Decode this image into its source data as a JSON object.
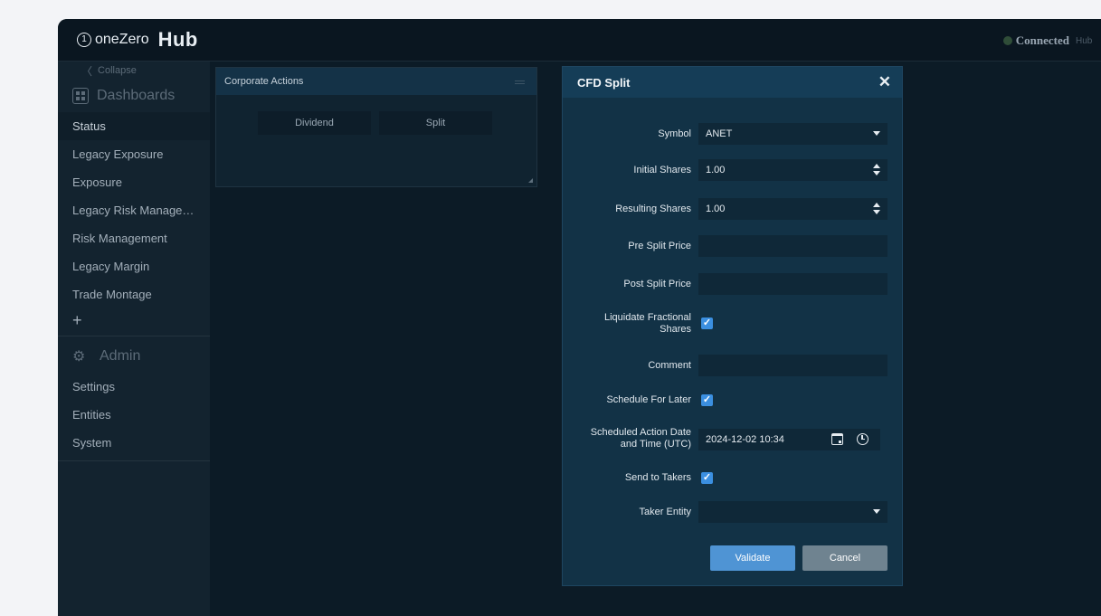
{
  "header": {
    "logo_mark": "1",
    "logo_text": "oneZero",
    "logo_hub": "Hub",
    "status": "Connected",
    "status_suffix": "Hub"
  },
  "sidebar": {
    "collapse_label": "Collapse",
    "dashboards_label": "Dashboards",
    "dashboard_items": [
      "Status",
      "Legacy Exposure",
      "Exposure",
      "Legacy Risk Manage…",
      "Risk Management",
      "Legacy Margin",
      "Trade Montage"
    ],
    "add_label": "+",
    "admin_label": "Admin",
    "admin_items": [
      "Settings",
      "Entities",
      "System"
    ]
  },
  "corporate_actions": {
    "title": "Corporate Actions",
    "dividend_label": "Dividend",
    "split_label": "Split"
  },
  "modal": {
    "title": "CFD Split",
    "close": "✕",
    "fields": {
      "symbol": {
        "label": "Symbol",
        "value": "ANET"
      },
      "initial_shares": {
        "label": "Initial Shares",
        "value": "1.00"
      },
      "resulting_shares": {
        "label": "Resulting Shares",
        "value": "1.00"
      },
      "pre_split_price": {
        "label": "Pre Split Price",
        "value": ""
      },
      "post_split_price": {
        "label": "Post Split Price",
        "value": ""
      },
      "liquidate_fractional": {
        "label_line1": "Liquidate Fractional",
        "label_line2": "Shares",
        "checked": true
      },
      "comment": {
        "label": "Comment",
        "value": ""
      },
      "schedule_for_later": {
        "label": "Schedule For Later",
        "checked": true
      },
      "scheduled_datetime": {
        "label_line1": "Scheduled Action Date",
        "label_line2": "and Time (UTC)",
        "value": "2024-12-02 10:34"
      },
      "send_to_takers": {
        "label": "Send to Takers",
        "checked": true
      },
      "taker_entity": {
        "label": "Taker Entity",
        "value": ""
      }
    },
    "validate_label": "Validate",
    "cancel_label": "Cancel",
    "check_glyph": "✓"
  }
}
